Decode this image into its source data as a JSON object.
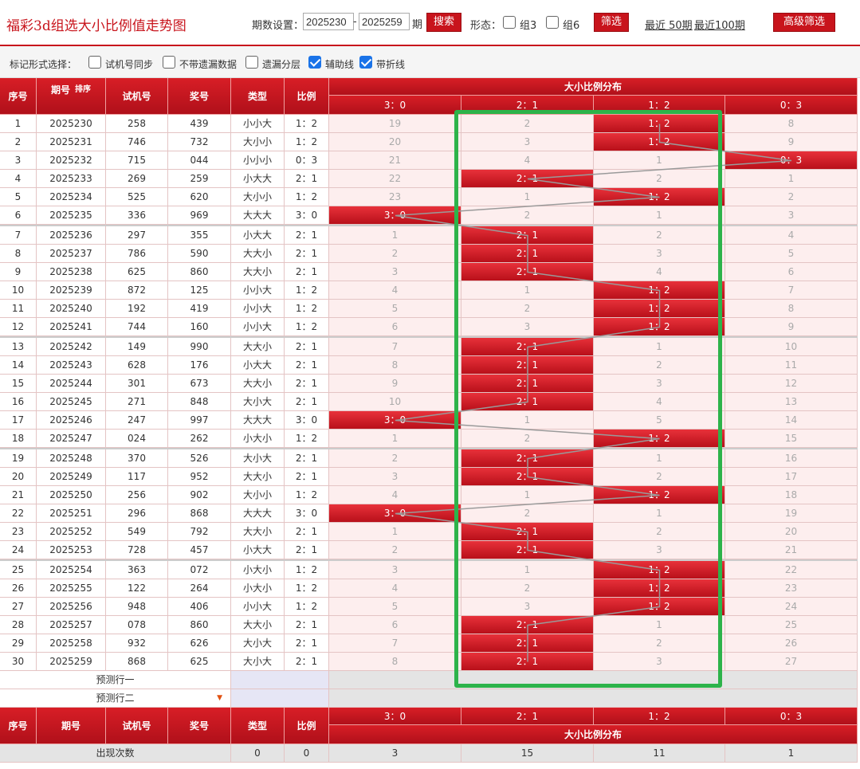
{
  "header": {
    "title": "福彩3d组选大小比例值走势图",
    "period_label": "期数设置：",
    "period_from": "2025230",
    "dash": "-",
    "period_to": "2025259",
    "period_suffix": "期",
    "search_label": "搜索",
    "form_label": "形态：",
    "zu3_label": "组3",
    "zu6_label": "组6",
    "filter_label": "筛选",
    "recent50": "最近 50期",
    "recent100": "最近100期",
    "advanced_label": "高级筛选"
  },
  "options": {
    "label": "标记形式选择：",
    "items": [
      {
        "label": "试机号同步",
        "checked": false
      },
      {
        "label": "不带遗漏数据",
        "checked": false
      },
      {
        "label": "遗漏分层",
        "checked": false
      },
      {
        "label": "辅助线",
        "checked": true
      },
      {
        "label": "带折线",
        "checked": true
      }
    ]
  },
  "table": {
    "headers": {
      "seq": "序号",
      "period": "期号",
      "sort": "排序",
      "trial": "试机号",
      "prize": "奖号",
      "type": "类型",
      "ratio": "比例",
      "dist": "大小比例分布"
    },
    "dist_cols": [
      "3：0",
      "2：1",
      "1：2",
      "0：3"
    ],
    "rows": [
      {
        "seq": "1",
        "period": "2025230",
        "trial": "258",
        "prize": "439",
        "type": "小小大",
        "ratio": "1：2",
        "miss": [
          "19",
          "2",
          "",
          "8"
        ],
        "hit": 2
      },
      {
        "seq": "2",
        "period": "2025231",
        "trial": "746",
        "prize": "732",
        "type": "大小小",
        "ratio": "1：2",
        "miss": [
          "20",
          "3",
          "",
          "9"
        ],
        "hit": 2
      },
      {
        "seq": "3",
        "period": "2025232",
        "trial": "715",
        "prize": "044",
        "type": "小小小",
        "ratio": "0：3",
        "miss": [
          "21",
          "4",
          "1",
          ""
        ],
        "hit": 3
      },
      {
        "seq": "4",
        "period": "2025233",
        "trial": "269",
        "prize": "259",
        "type": "小大大",
        "ratio": "2：1",
        "miss": [
          "22",
          "",
          "2",
          "1"
        ],
        "hit": 1
      },
      {
        "seq": "5",
        "period": "2025234",
        "trial": "525",
        "prize": "620",
        "type": "大小小",
        "ratio": "1：2",
        "miss": [
          "23",
          "1",
          "",
          "2"
        ],
        "hit": 2
      },
      {
        "seq": "6",
        "period": "2025235",
        "trial": "336",
        "prize": "969",
        "type": "大大大",
        "ratio": "3：0",
        "miss": [
          "",
          "2",
          "1",
          "3"
        ],
        "hit": 0
      },
      {
        "seq": "7",
        "period": "2025236",
        "trial": "297",
        "prize": "355",
        "type": "小大大",
        "ratio": "2：1",
        "miss": [
          "1",
          "",
          "2",
          "4"
        ],
        "hit": 1
      },
      {
        "seq": "8",
        "period": "2025237",
        "trial": "786",
        "prize": "590",
        "type": "大大小",
        "ratio": "2：1",
        "miss": [
          "2",
          "",
          "3",
          "5"
        ],
        "hit": 1
      },
      {
        "seq": "9",
        "period": "2025238",
        "trial": "625",
        "prize": "860",
        "type": "大大小",
        "ratio": "2：1",
        "miss": [
          "3",
          "",
          "4",
          "6"
        ],
        "hit": 1
      },
      {
        "seq": "10",
        "period": "2025239",
        "trial": "872",
        "prize": "125",
        "type": "小小大",
        "ratio": "1：2",
        "miss": [
          "4",
          "1",
          "",
          "7"
        ],
        "hit": 2
      },
      {
        "seq": "11",
        "period": "2025240",
        "trial": "192",
        "prize": "419",
        "type": "小小大",
        "ratio": "1：2",
        "miss": [
          "5",
          "2",
          "",
          "8"
        ],
        "hit": 2
      },
      {
        "seq": "12",
        "period": "2025241",
        "trial": "744",
        "prize": "160",
        "type": "小小大",
        "ratio": "1：2",
        "miss": [
          "6",
          "3",
          "",
          "9"
        ],
        "hit": 2
      },
      {
        "seq": "13",
        "period": "2025242",
        "trial": "149",
        "prize": "990",
        "type": "大大小",
        "ratio": "2：1",
        "miss": [
          "7",
          "",
          "1",
          "10"
        ],
        "hit": 1
      },
      {
        "seq": "14",
        "period": "2025243",
        "trial": "628",
        "prize": "176",
        "type": "小大大",
        "ratio": "2：1",
        "miss": [
          "8",
          "",
          "2",
          "11"
        ],
        "hit": 1
      },
      {
        "seq": "15",
        "period": "2025244",
        "trial": "301",
        "prize": "673",
        "type": "大大小",
        "ratio": "2：1",
        "miss": [
          "9",
          "",
          "3",
          "12"
        ],
        "hit": 1
      },
      {
        "seq": "16",
        "period": "2025245",
        "trial": "271",
        "prize": "848",
        "type": "大小大",
        "ratio": "2：1",
        "miss": [
          "10",
          "",
          "4",
          "13"
        ],
        "hit": 1
      },
      {
        "seq": "17",
        "period": "2025246",
        "trial": "247",
        "prize": "997",
        "type": "大大大",
        "ratio": "3：0",
        "miss": [
          "",
          "1",
          "5",
          "14"
        ],
        "hit": 0
      },
      {
        "seq": "18",
        "period": "2025247",
        "trial": "024",
        "prize": "262",
        "type": "小大小",
        "ratio": "1：2",
        "miss": [
          "1",
          "2",
          "",
          "15"
        ],
        "hit": 2
      },
      {
        "seq": "19",
        "period": "2025248",
        "trial": "370",
        "prize": "526",
        "type": "大小大",
        "ratio": "2：1",
        "miss": [
          "2",
          "",
          "1",
          "16"
        ],
        "hit": 1
      },
      {
        "seq": "20",
        "period": "2025249",
        "trial": "117",
        "prize": "952",
        "type": "大大小",
        "ratio": "2：1",
        "miss": [
          "3",
          "",
          "2",
          "17"
        ],
        "hit": 1
      },
      {
        "seq": "21",
        "period": "2025250",
        "trial": "256",
        "prize": "902",
        "type": "大小小",
        "ratio": "1：2",
        "miss": [
          "4",
          "1",
          "",
          "18"
        ],
        "hit": 2
      },
      {
        "seq": "22",
        "period": "2025251",
        "trial": "296",
        "prize": "868",
        "type": "大大大",
        "ratio": "3：0",
        "miss": [
          "",
          "2",
          "1",
          "19"
        ],
        "hit": 0
      },
      {
        "seq": "23",
        "period": "2025252",
        "trial": "549",
        "prize": "792",
        "type": "大大小",
        "ratio": "2：1",
        "miss": [
          "1",
          "",
          "2",
          "20"
        ],
        "hit": 1
      },
      {
        "seq": "24",
        "period": "2025253",
        "trial": "728",
        "prize": "457",
        "type": "小大大",
        "ratio": "2：1",
        "miss": [
          "2",
          "",
          "3",
          "21"
        ],
        "hit": 1
      },
      {
        "seq": "25",
        "period": "2025254",
        "trial": "363",
        "prize": "072",
        "type": "小大小",
        "ratio": "1：2",
        "miss": [
          "3",
          "1",
          "",
          "22"
        ],
        "hit": 2
      },
      {
        "seq": "26",
        "period": "2025255",
        "trial": "122",
        "prize": "264",
        "type": "小大小",
        "ratio": "1：2",
        "miss": [
          "4",
          "2",
          "",
          "23"
        ],
        "hit": 2
      },
      {
        "seq": "27",
        "period": "2025256",
        "trial": "948",
        "prize": "406",
        "type": "小小大",
        "ratio": "1：2",
        "miss": [
          "5",
          "3",
          "",
          "24"
        ],
        "hit": 2
      },
      {
        "seq": "28",
        "period": "2025257",
        "trial": "078",
        "prize": "860",
        "type": "大大小",
        "ratio": "2：1",
        "miss": [
          "6",
          "",
          "1",
          "25"
        ],
        "hit": 1
      },
      {
        "seq": "29",
        "period": "2025258",
        "trial": "932",
        "prize": "626",
        "type": "大小大",
        "ratio": "2：1",
        "miss": [
          "7",
          "",
          "2",
          "26"
        ],
        "hit": 1
      },
      {
        "seq": "30",
        "period": "2025259",
        "trial": "868",
        "prize": "625",
        "type": "大小大",
        "ratio": "2：1",
        "miss": [
          "8",
          "",
          "3",
          "27"
        ],
        "hit": 1
      }
    ],
    "predict1": "预测行一",
    "predict2": "预测行二",
    "counts_label": "出现次数",
    "counts": [
      "0",
      "0",
      "3",
      "15",
      "11",
      "1"
    ]
  },
  "colors": {
    "brand_red": "#c8141c",
    "highlight_green": "#2db34a",
    "row_pink": "#fdeeee"
  }
}
